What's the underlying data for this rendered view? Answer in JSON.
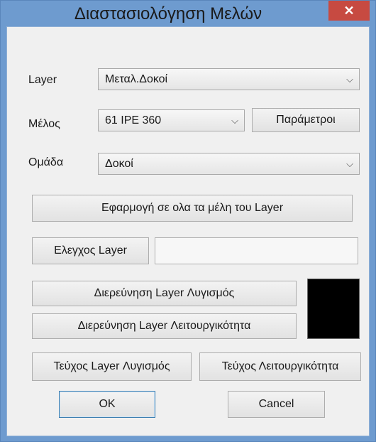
{
  "window": {
    "title": "Διαστασιολόγηση Μελών",
    "close": "✕"
  },
  "form": {
    "layer_label": "Layer",
    "layer_value": "Μεταλ.Δοκοί",
    "member_label": "Μέλος",
    "member_value": "61 IPE 360",
    "params_button": "Παράμετροι",
    "group_label": "Ομάδα",
    "group_value": "Δοκοί",
    "apply_all_button": "Εφαρμογή σε ολα τα μέλη του Layer",
    "check_layer_button": "Ελεγχος Layer",
    "check_layer_field": "",
    "investigate_failure_button": "Διερεύνηση Layer Λυγισμός",
    "investigate_function_button": "Διερεύνηση Layer Λειτουργικότητα",
    "report_failure_button": "Τεύχος Layer Λυγισμός",
    "report_function_button": "Τεύχος Λειτουργικότητα",
    "ok_button": "OK",
    "cancel_button": "Cancel",
    "color_swatch": "#000000"
  },
  "icons": {
    "dropdown": "chevron-down-icon",
    "close": "close-icon"
  }
}
